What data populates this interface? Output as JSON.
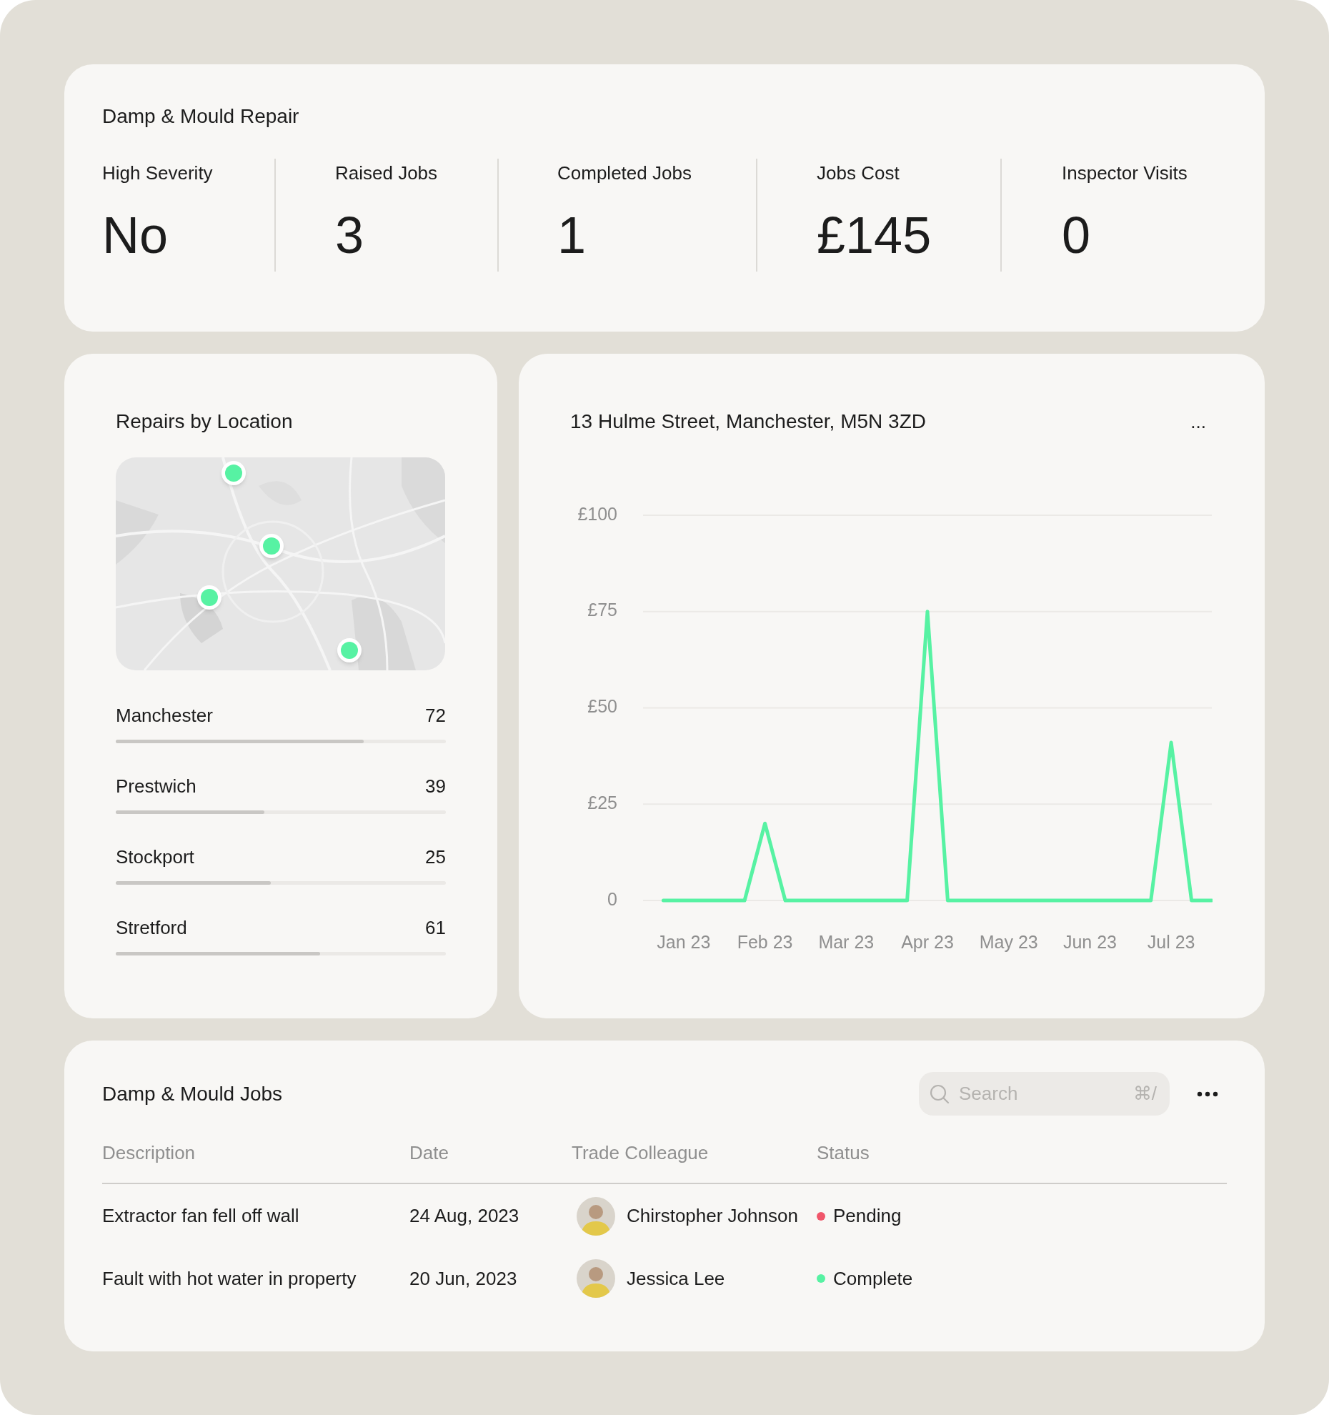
{
  "summary": {
    "title": "Damp & Mould Repair",
    "stats": [
      {
        "label": "High Severity",
        "value": "No"
      },
      {
        "label": "Raised Jobs",
        "value": "3"
      },
      {
        "label": "Completed Jobs",
        "value": "1"
      },
      {
        "label": "Jobs Cost",
        "value": "£145"
      },
      {
        "label": "Inspector Visits",
        "value": "0"
      }
    ]
  },
  "locations_card": {
    "title": "Repairs by Location",
    "locations": [
      {
        "name": "Manchester",
        "count": "72",
        "level": 0.75
      },
      {
        "name": "Prestwich",
        "count": "39",
        "level": 0.45
      },
      {
        "name": "Stockport",
        "count": "25",
        "level": 0.47
      },
      {
        "name": "Stretford",
        "count": "61",
        "level": 0.62
      }
    ]
  },
  "chart_card": {
    "title": "13 Hulme Street, Manchester, M5N 3ZD",
    "menu": "...",
    "chart_data": {
      "type": "line",
      "categories": [
        null,
        "Jan 23",
        null,
        null,
        null,
        "Feb 23",
        null,
        null,
        null,
        "Mar 23",
        null,
        null,
        null,
        "Apr 23",
        null,
        null,
        null,
        "May 23",
        null,
        null,
        null,
        "Jun 23",
        null,
        null,
        null,
        "Jul 23",
        null,
        null
      ],
      "series": [
        {
          "color": "#57f2a3",
          "values": [
            0,
            0,
            0,
            0,
            0,
            20,
            0,
            0,
            0,
            0,
            0,
            0,
            0,
            75,
            0,
            0,
            0,
            0,
            0,
            0,
            0,
            0,
            0,
            0,
            0,
            41,
            0,
            0
          ]
        }
      ],
      "ylim": [
        0,
        100
      ],
      "grid": true,
      "yticks": [
        {
          "value": 0,
          "label": "0"
        },
        {
          "value": 25,
          "label": "£25"
        },
        {
          "value": 50,
          "label": "£50"
        },
        {
          "value": 75,
          "label": "£75"
        },
        {
          "value": 100,
          "label": "£100"
        }
      ]
    }
  },
  "jobs": {
    "title": "Damp & Mould Jobs",
    "search": {
      "placeholder": "Search",
      "shortcut": "⌘/"
    },
    "columns": [
      "Description",
      "Date",
      "Trade Colleague",
      "Status"
    ],
    "rows": [
      {
        "description": "Extractor fan fell off wall",
        "date": "24 Aug, 2023",
        "colleague": "Chirstopher Johnson",
        "status": "Pending",
        "color": "#f0566a"
      },
      {
        "description": "Fault with hot water in property",
        "date": "20 Jun, 2023",
        "colleague": "Jessica Lee",
        "status": "Complete",
        "color": "#57f2a3"
      }
    ]
  }
}
